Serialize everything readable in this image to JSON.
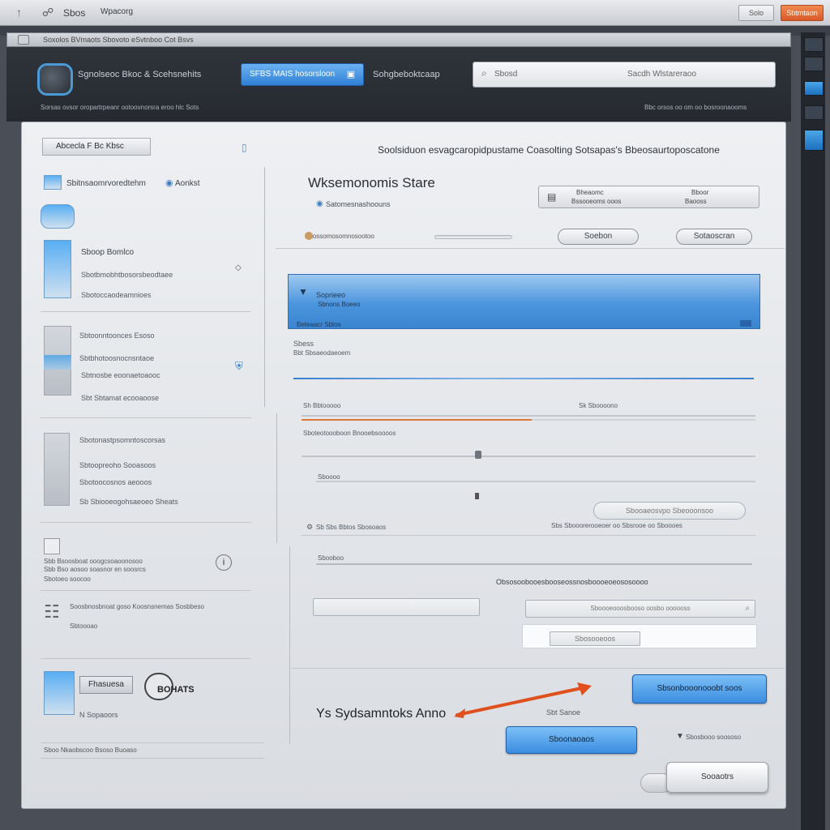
{
  "titlebar": {
    "app_name": "Sbos",
    "subtitle": "Wpacorg",
    "btn1": "Solo",
    "btn2": "Sbtmtaon"
  },
  "tabbar": {
    "path": "Soxolos BVmaots Sbovoto eSvtnboo Cot Bsvs"
  },
  "header": {
    "app_title": "Sgnolseoc Bkoc & Scehsnehits",
    "primary_button": "SFBS MAIS hosorsloon",
    "link_text": "Sohgbeboktcaap",
    "search_placeholder": "Sbosd",
    "search_value": "Sacdh Wlstareraoo",
    "left_caption": "Sorsas ovsor oropartrpeanr ootoovnorsra eroo hlc Sots",
    "right_caption": "Bbc orsos oo om oo bosroonaooms"
  },
  "sidebar": {
    "header": "Abcecla F Bc Kbsc",
    "top_label": "Sbitnsaomrvoredtehm",
    "top_badge": "Aonkst",
    "group1": [
      "Sboop Bomlco",
      "Sbotbmobhtbosorsbeodtaee",
      "Sbotoccaodeamnioes"
    ],
    "group2": [
      "Sbtoonntoonces Esoso",
      "Sbtbhotoosnocnsntaoe",
      "Sbtnosbe eoonaetoaooc",
      "Sbt Sbtamat ecooaoose"
    ],
    "group3": [
      "Sbotonastpsomntoscorsas",
      "Sbtoopreoho Sooasoos",
      "Sbotoocosnos aeooos",
      "Sb Sbiooeogohsaeoeo Sheats"
    ],
    "group4": [
      "Sbb Bsoosboat ooogcsoaoonosoo",
      "Sbb Bso aosoo soasnor en soosrcs",
      "Sbotoeo soocoo"
    ],
    "group5": [
      "Soosbnosbnoat goso Koosnsnemas Sosbbeso",
      "Sbtoooao"
    ],
    "bottom_button": "Fhasuesa",
    "bottom_logo_text": "BOHATS",
    "bottom_caption": "N Sopaoors",
    "footer": "Sboo Nkaobscoo Bsoso Buoaso"
  },
  "content": {
    "headline": "Soolsiduon esvagcaropidpustame Coasolting Sotsapas's Bbeosaurtoposcatone",
    "title": "Wksemonomis Stare",
    "subtitle": "Satomesnashoouns",
    "info_left_top": "Bheaomc",
    "info_left_bottom": "Bssooeoms ooos",
    "info_right_top": "Bboor",
    "info_right_bottom": "Baooss",
    "slider_label": "Baossomosomnosootoo",
    "pill1": "Soebon",
    "pill2": "Sotaoscran",
    "banner_title": "Soprieeo",
    "banner_sub": "Sbnons Boeeo",
    "banner_foot": "Beteaacr Sbtos",
    "section_label": "Sbess",
    "section_sub": "Bbt Sbsaeodaeoem",
    "row1_left": "Sh Bbtooooo",
    "row1_right": "Sk Sboooono",
    "row2": "Sboteotoooboon Bnooebsoooos",
    "row3": "Sboooo",
    "field1": "Sbooaeosvpo Sbeooonsoo",
    "row4_left": "Sb Sbs Bbtos Sbosoaos",
    "row4_right": "Sbs Sbooorerooeoer oo Sbsrooe oo Sboooes",
    "row5": "Sbooboo",
    "group_label": "Obsosoobooesbooseossnosboooeoeososoooo",
    "field2": "Sboooeooosbooso oosbo oooooss",
    "field3": "Sbosooeoos",
    "primary_action": "Sbsonbooonooobt soos",
    "arrow_label": "Ys Sydsamntoks Anno",
    "center_label": "Sbt Sanoe",
    "secondary_action": "Sboonaoaos",
    "right_note": "Sbosbooo soososo",
    "cancel_button": "Sooaotrs"
  },
  "colors": {
    "accent": "#3b8de0",
    "arrow": "#e0501f",
    "orange_line": "#e07a3a"
  }
}
